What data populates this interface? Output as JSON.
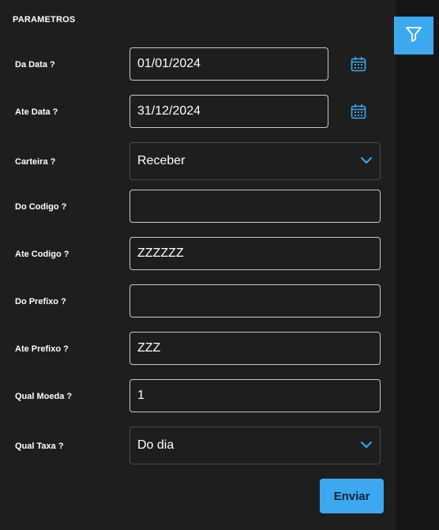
{
  "header": {
    "title": "PARAMETROS"
  },
  "fields": [
    {
      "label": "Da Data ?",
      "value": "01/01/2024",
      "type": "date"
    },
    {
      "label": "Ate Data ?",
      "value": "31/12/2024",
      "type": "date"
    },
    {
      "label": "Carteira ?",
      "value": "Receber",
      "type": "select"
    },
    {
      "label": "Do Codigo ?",
      "value": "",
      "type": "text"
    },
    {
      "label": "Ate Codigo ?",
      "value": "ZZZZZZ",
      "type": "text"
    },
    {
      "label": "Do Prefixo ?",
      "value": "",
      "type": "text"
    },
    {
      "label": "Ate Prefixo ?",
      "value": "ZZZ",
      "type": "text"
    },
    {
      "label": "Qual Moeda ?",
      "value": "1",
      "type": "text"
    },
    {
      "label": "Qual Taxa ?",
      "value": "Do dia",
      "type": "select"
    }
  ],
  "actions": {
    "submit_label": "Enviar"
  },
  "colors": {
    "accent": "#3ca8f0",
    "background": "#1e1e1e",
    "sidebar": "#161616",
    "text": "#ffffff",
    "border": "#c8c8c8"
  },
  "icons": {
    "filter": "filter-icon",
    "calendar": "calendar-icon",
    "dropdown": "chevron-down-icon"
  }
}
